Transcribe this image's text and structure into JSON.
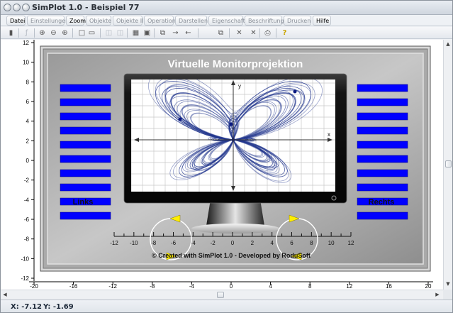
{
  "window": {
    "title": "SimPlot 1.0 - Beispiel 77"
  },
  "menu": [
    {
      "label": "Datei",
      "enabled": true
    },
    {
      "label": "Einstellungen",
      "enabled": false
    },
    {
      "label": "Zoom",
      "enabled": true
    },
    {
      "label": "Objekte I",
      "enabled": false
    },
    {
      "label": "Objekte II",
      "enabled": false
    },
    {
      "label": "Operation",
      "enabled": false
    },
    {
      "label": "Darstellen",
      "enabled": false
    },
    {
      "label": "Eigenschaft",
      "enabled": false
    },
    {
      "label": "Beschriftung",
      "enabled": false
    },
    {
      "label": "Drucken",
      "enabled": false
    },
    {
      "label": "Hilfe",
      "enabled": true
    }
  ],
  "toolbar": [
    {
      "icon": "calculator-icon",
      "glyph": "▮"
    },
    {
      "icon": "function-icon",
      "glyph": "ƒ"
    },
    {
      "icon": "zoom-in-icon",
      "glyph": "⊕"
    },
    {
      "icon": "zoom-out-icon",
      "glyph": "⊖"
    },
    {
      "icon": "zoom-fit-icon",
      "glyph": "⊕"
    },
    {
      "icon": "select-rect-icon",
      "glyph": "□"
    },
    {
      "icon": "coordinates-icon",
      "glyph": "▭"
    },
    {
      "icon": "object-icon",
      "glyph": "◫"
    },
    {
      "icon": "object2-icon",
      "glyph": "◫"
    },
    {
      "icon": "table-icon",
      "glyph": "▦"
    },
    {
      "icon": "screen-icon",
      "glyph": "▣"
    },
    {
      "icon": "copy-icon",
      "glyph": "⧉"
    },
    {
      "icon": "arrow-right-icon",
      "glyph": "→"
    },
    {
      "icon": "arrow-left-icon",
      "glyph": "←"
    },
    {
      "icon": "pages-icon",
      "glyph": "⧉"
    },
    {
      "icon": "delete-icon",
      "glyph": "✕"
    },
    {
      "icon": "delete-all-icon",
      "glyph": "✕"
    },
    {
      "icon": "print-icon",
      "glyph": "⎙"
    },
    {
      "icon": "help-icon",
      "glyph": "?"
    }
  ],
  "plot": {
    "x_ticks": [
      "-20",
      "-16",
      "-12",
      "-8",
      "-4",
      "0",
      "4",
      "8",
      "12",
      "16",
      "20"
    ],
    "y_ticks": [
      "12",
      "10",
      "8",
      "6",
      "4",
      "2",
      "0",
      "-2",
      "-4",
      "-6",
      "-8",
      "-10",
      "-12"
    ],
    "scene_title": "Virtuelle Monitorprojektion",
    "left_label": "Links",
    "right_label": "Rechts",
    "inner_x_label": "x",
    "inner_y_label": "y",
    "ruler_ticks": [
      "-12",
      "-10",
      "-8",
      "-6",
      "-4",
      "-2",
      "0",
      "2",
      "4",
      "6",
      "8",
      "10",
      "12"
    ],
    "credit": "© Created with SimPlot 1.0 - Developed by RoduSoft",
    "colors": {
      "bars": "#0000ff",
      "curve": "#1a2f8a",
      "arrow": "#ffee00",
      "frame": "#777777"
    }
  },
  "status": {
    "x": "X: -7.12",
    "y": "Y: -1.69"
  }
}
